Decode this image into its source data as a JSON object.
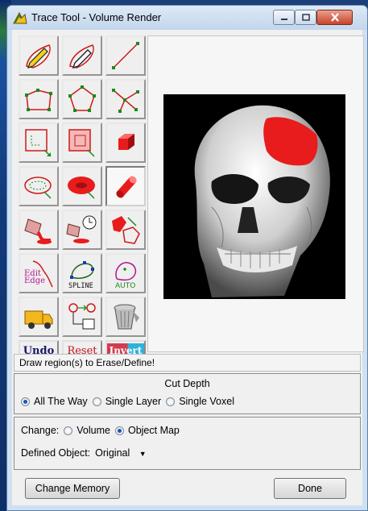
{
  "window": {
    "title": "Trace Tool - Volume Render",
    "controls": [
      "minimize",
      "maximize",
      "close"
    ]
  },
  "tools": [
    {
      "name": "freehand-pencil-outline",
      "icon": "pencil-red-outline-icon"
    },
    {
      "name": "freehand-pencil-fill",
      "icon": "pencil-red-fill-icon"
    },
    {
      "name": "line",
      "icon": "line-icon"
    },
    {
      "name": "polygon-open",
      "icon": "polygon-open-icon"
    },
    {
      "name": "polygon",
      "icon": "pentagon-icon"
    },
    {
      "name": "star-lines",
      "icon": "star-lines-icon"
    },
    {
      "name": "rectangle-outline",
      "icon": "rectangle-outline-icon"
    },
    {
      "name": "rectangle-fill",
      "icon": "rectangle-fill-icon"
    },
    {
      "name": "cube",
      "icon": "cube-icon"
    },
    {
      "name": "ellipse-outline",
      "icon": "ellipse-outline-icon"
    },
    {
      "name": "ellipse-fill",
      "icon": "ellipse-fill-icon"
    },
    {
      "name": "cylinder",
      "icon": "cylinder-icon",
      "selected": true
    },
    {
      "name": "paint-bucket",
      "icon": "paint-bucket-icon"
    },
    {
      "name": "bucket-timer",
      "icon": "bucket-timer-icon"
    },
    {
      "name": "region-transform",
      "icon": "region-transform-icon"
    },
    {
      "name": "edit-edge",
      "icon": "edit-edge-icon",
      "label": "Edit Edge"
    },
    {
      "name": "spline",
      "icon": "spline-icon",
      "label": "SPLINE"
    },
    {
      "name": "auto",
      "icon": "auto-icon",
      "label": "AUTO"
    },
    {
      "name": "truck",
      "icon": "truck-icon"
    },
    {
      "name": "object-map",
      "icon": "object-map-icon"
    },
    {
      "name": "trash",
      "icon": "trash-icon"
    }
  ],
  "buttons": {
    "undo": "Undo",
    "reset": "Reset",
    "invert_a": "Inv",
    "invert_b": "ert"
  },
  "status": "Draw region(s) to Erase/Define!",
  "cut_depth": {
    "title": "Cut Depth",
    "options": [
      "All The Way",
      "Single Layer",
      "Single Voxel"
    ],
    "selected": "All The Way"
  },
  "change": {
    "label": "Change:",
    "options": [
      "Volume",
      "Object Map"
    ],
    "selected": "Object Map"
  },
  "defined_object": {
    "label": "Defined Object:",
    "value": "Original"
  },
  "footer": {
    "change_memory": "Change Memory",
    "done": "Done"
  },
  "colors": {
    "accent_red": "#e81c1c",
    "render_background": "#000000"
  }
}
